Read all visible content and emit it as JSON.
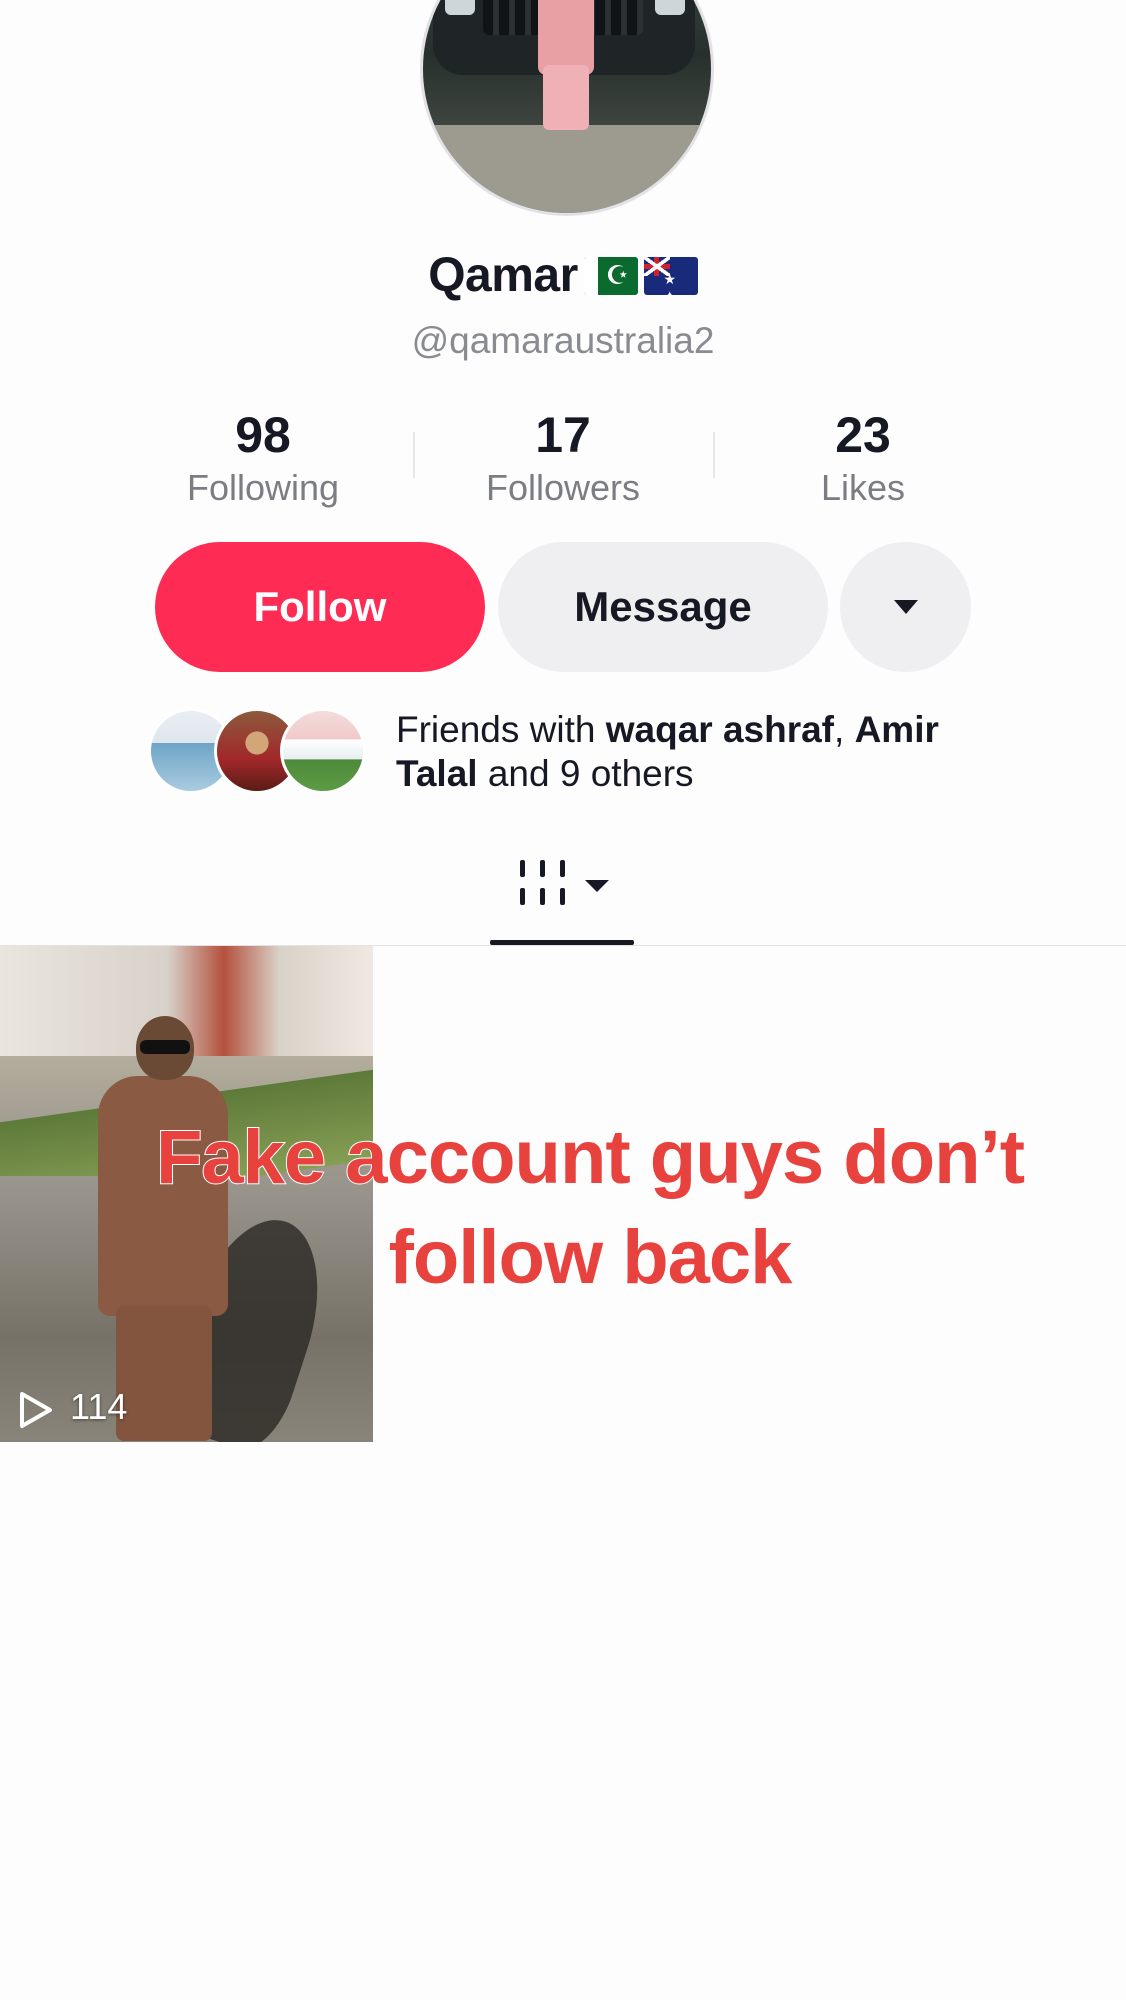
{
  "profile": {
    "display_name": "Qamar",
    "flags": [
      "pakistan-flag",
      "australia-flag"
    ],
    "username": "@qamaraustralia2"
  },
  "stats": {
    "following": {
      "value": "98",
      "label": "Following"
    },
    "followers": {
      "value": "17",
      "label": "Followers"
    },
    "likes": {
      "value": "23",
      "label": "Likes"
    }
  },
  "actions": {
    "follow_label": "Follow",
    "message_label": "Message",
    "more_icon": "caret-down-icon"
  },
  "friends": {
    "prefix": "Friends with ",
    "name1": "waqar ashraf",
    "separator": ", ",
    "name2": "Amir Talal",
    "suffix": " and 9 others"
  },
  "tabs": {
    "active_icon": "videos-grid-icon"
  },
  "videos": [
    {
      "views": "114",
      "caption": "Fake account guys don’t follow back"
    }
  ],
  "colors": {
    "follow_button": "#fe2c55",
    "secondary_button": "#efeff1",
    "caption_text": "#e8423f"
  }
}
